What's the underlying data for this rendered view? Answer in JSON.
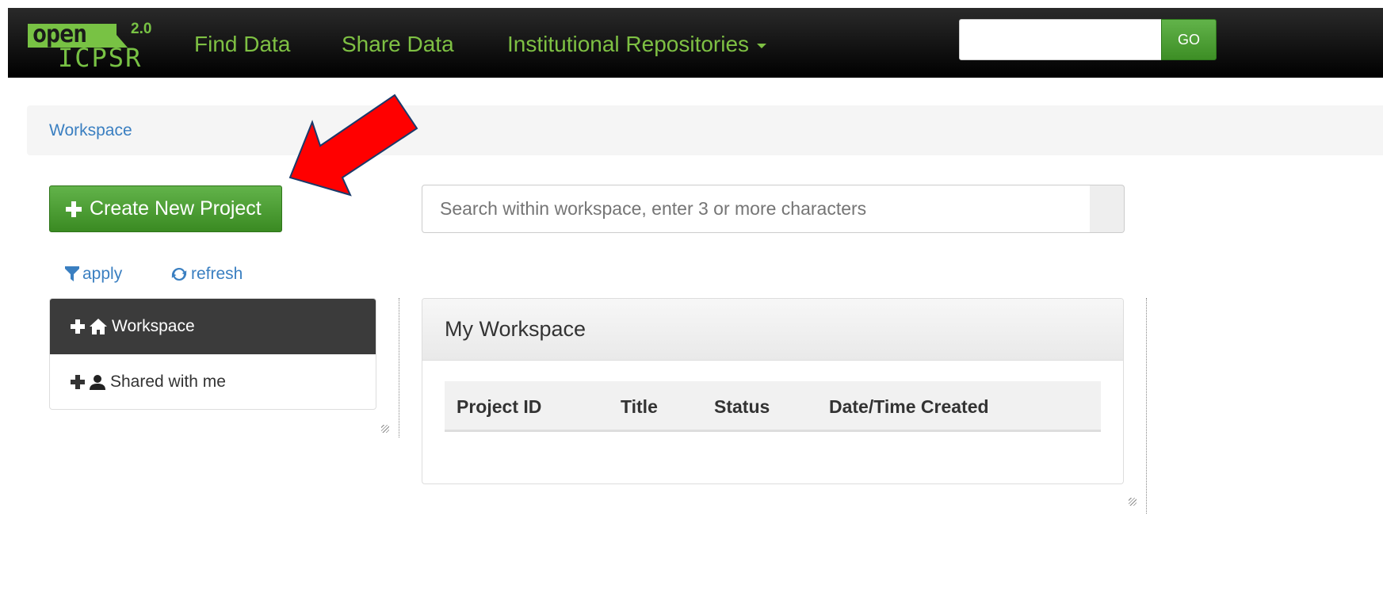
{
  "navbar": {
    "logo": {
      "open": "open",
      "version": "2.0",
      "icpsr": "ICPSR"
    },
    "links": [
      "Find Data",
      "Share Data",
      "Institutional Repositories"
    ],
    "search_value": "",
    "go_label": "GO"
  },
  "breadcrumb": {
    "label": "Workspace"
  },
  "toolbar": {
    "create_label": "Create New Project",
    "search_placeholder": "Search within workspace, enter 3 or more characters",
    "apply_label": "apply",
    "refresh_label": "refresh"
  },
  "tree": {
    "items": [
      {
        "label": "Workspace",
        "icon": "home-icon",
        "active": true
      },
      {
        "label": "Shared with me",
        "icon": "user-icon",
        "active": false
      }
    ]
  },
  "panel": {
    "title": "My Workspace",
    "columns": [
      "Project ID",
      "Title",
      "Status",
      "Date/Time Created"
    ],
    "rows": []
  },
  "colors": {
    "nav_link": "#7ec043",
    "button_green": "#4a9d32",
    "link_blue": "#3a7fc1",
    "tree_active": "#3b3b3b",
    "annotation_arrow": "#ff0000"
  }
}
